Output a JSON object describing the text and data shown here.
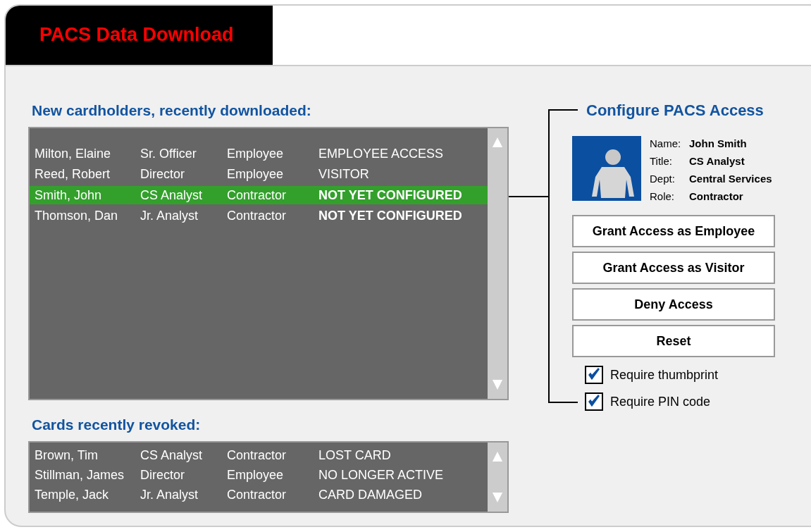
{
  "title": "PACS Data Download",
  "new_cardholders": {
    "heading": "New cardholders, recently downloaded:",
    "rows": [
      {
        "name": "Milton, Elaine",
        "title": "Sr. Officer",
        "type": "Employee",
        "status": "EMPLOYEE ACCESS",
        "configured": true,
        "selected": false
      },
      {
        "name": "Reed, Robert",
        "title": "Director",
        "type": "Employee",
        "status": "VISITOR",
        "configured": true,
        "selected": false
      },
      {
        "name": "Smith, John",
        "title": "CS Analyst",
        "type": "Contractor",
        "status": "NOT YET CONFIGURED",
        "configured": false,
        "selected": true
      },
      {
        "name": "Thomson, Dan",
        "title": "Jr. Analyst",
        "type": "Contractor",
        "status": "NOT YET CONFIGURED",
        "configured": false,
        "selected": false
      }
    ]
  },
  "revoked": {
    "heading": "Cards recently revoked:",
    "rows": [
      {
        "name": "Brown, Tim",
        "title": "CS Analyst",
        "type": "Contractor",
        "status": "LOST CARD"
      },
      {
        "name": "Stillman, James",
        "title": "Director",
        "type": "Employee",
        "status": "NO LONGER ACTIVE"
      },
      {
        "name": "Temple, Jack",
        "title": "Jr. Analyst",
        "type": "Contractor",
        "status": "CARD DAMAGED"
      }
    ]
  },
  "configure": {
    "heading": "Configure PACS Access",
    "details": [
      {
        "label": "Name:",
        "value": "John Smith"
      },
      {
        "label": "Title:",
        "value": "CS Analyst"
      },
      {
        "label": "Dept:",
        "value": "Central Services"
      },
      {
        "label": "Role:",
        "value": "Contractor"
      }
    ],
    "buttons": [
      "Grant Access as Employee",
      "Grant Access as Visitor",
      "Deny Access",
      "Reset"
    ],
    "options": [
      {
        "label": "Require thumbprint",
        "checked": true
      },
      {
        "label": "Require PIN code",
        "checked": true
      }
    ]
  }
}
